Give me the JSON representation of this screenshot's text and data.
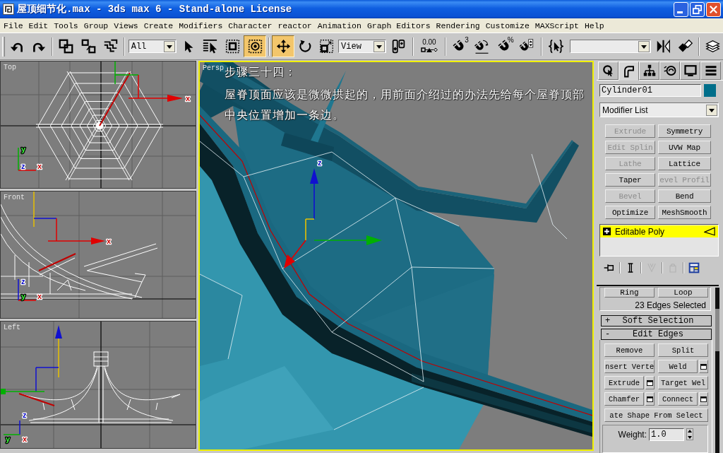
{
  "window": {
    "title": "屋顶细节化.max - 3ds max 6 - Stand-alone License",
    "controls": [
      {
        "kind": "minimize"
      },
      {
        "kind": "restore"
      },
      {
        "kind": "close"
      }
    ]
  },
  "menu": [
    "File",
    "Edit",
    "Tools",
    "Group",
    "Views",
    "Create",
    "Modifiers",
    "Character",
    "reactor",
    "Animation",
    "Graph Editors",
    "Rendering",
    "Customize",
    "MAXScript",
    "Help"
  ],
  "toolbar": [
    {
      "kind": "undo",
      "active": false
    },
    {
      "kind": "redo",
      "active": false
    },
    {
      "kind": "separator"
    },
    {
      "kind": "link",
      "active": false
    },
    {
      "kind": "unlink",
      "active": false
    },
    {
      "kind": "bind",
      "active": false
    },
    {
      "kind": "separator"
    },
    {
      "kind": "dropdown",
      "value": "All"
    },
    {
      "kind": "select",
      "active": false
    },
    {
      "kind": "select-by-name",
      "active": false
    },
    {
      "kind": "region",
      "active": false
    },
    {
      "kind": "crossing",
      "active": true
    },
    {
      "kind": "separator"
    },
    {
      "kind": "move",
      "active": true
    },
    {
      "kind": "rotate",
      "active": false
    },
    {
      "kind": "scale",
      "active": false
    },
    {
      "kind": "dropdown",
      "value": "View"
    },
    {
      "kind": "pivot",
      "active": false
    },
    {
      "kind": "separator"
    },
    {
      "kind": "spinner-snap",
      "badge": "0.00",
      "active": false
    },
    {
      "kind": "separator"
    },
    {
      "kind": "snap",
      "badge": "3",
      "active": false
    },
    {
      "kind": "angle-snap",
      "active": false
    },
    {
      "kind": "percent-snap",
      "badge": "%",
      "active": false
    },
    {
      "kind": "spinner-toggle",
      "active": false
    },
    {
      "kind": "separator"
    },
    {
      "kind": "named-sets",
      "active": false
    },
    {
      "kind": "named-field"
    },
    {
      "kind": "mirror",
      "active": false
    },
    {
      "kind": "align",
      "active": false
    },
    {
      "kind": "separator"
    },
    {
      "kind": "layers",
      "active": false
    }
  ],
  "viewports": [
    {
      "kind": "top",
      "label": "Top",
      "active": false,
      "axis_labels": [
        "x",
        "y",
        "z",
        "x"
      ]
    },
    {
      "kind": "front",
      "label": "Front",
      "active": false,
      "axis_labels": [
        "x",
        "z",
        "y",
        "x"
      ]
    },
    {
      "kind": "left",
      "label": "Left",
      "active": false,
      "axis_labels": [
        "z",
        "y",
        "x"
      ]
    }
  ],
  "perspective_viewport": {
    "label": "Persp",
    "active": true,
    "axis_labels": [
      "z"
    ],
    "heading": "步骤三十四：",
    "lines": [
      "屋脊顶面应该是微微拱起的，用前面介绍过的办法先给每个屋脊顶部",
      "中央位置增加一条边。"
    ]
  },
  "command_panel": {
    "tabs": [
      {
        "kind": "create",
        "selected": false
      },
      {
        "kind": "modify",
        "selected": true
      },
      {
        "kind": "hierarchy",
        "selected": false
      },
      {
        "kind": "motion",
        "selected": false
      },
      {
        "kind": "display",
        "selected": false
      },
      {
        "kind": "utilities",
        "selected": false
      }
    ],
    "object": {
      "name": "Cylinder01",
      "color": "#006e8a"
    },
    "modifier_list": "Modifier List",
    "modifier_buttons": [
      {
        "label": "Extrude",
        "disabled": true
      },
      {
        "label": "Symmetry",
        "disabled": false
      },
      {
        "label": "Edit Splin",
        "disabled": true
      },
      {
        "label": "UVW Map",
        "disabled": false
      },
      {
        "label": "Lathe",
        "disabled": true
      },
      {
        "label": "Lattice",
        "disabled": false
      },
      {
        "label": "Taper",
        "disabled": false
      },
      {
        "label": "evel Profil",
        "disabled": true
      },
      {
        "label": "Bevel",
        "disabled": true
      },
      {
        "label": "Bend",
        "disabled": false
      },
      {
        "label": "Optimize",
        "disabled": false
      },
      {
        "label": "MeshSmooth",
        "disabled": false
      }
    ],
    "stack": [
      {
        "label": "Editable Poly",
        "selected": true
      }
    ],
    "stack_tools": [
      {
        "kind": "pin",
        "disabled": false
      },
      {
        "kind": "show-end-result",
        "disabled": false
      },
      {
        "kind": "make-unique",
        "disabled": true
      },
      {
        "kind": "remove",
        "disabled": true
      },
      {
        "kind": "configure",
        "disabled": false
      }
    ],
    "selection": {
      "buttons": [
        "Ring",
        "Loop"
      ],
      "status": "23 Edges Selected"
    },
    "rollouts": [
      {
        "sign": "+",
        "title": "Soft Selection",
        "expanded": false
      },
      {
        "sign": "-",
        "title": "Edit Edges",
        "expanded": true,
        "buttons": [
          {
            "label": "Remove",
            "settings": false,
            "wide": false
          },
          {
            "label": "Split",
            "settings": false,
            "wide": false
          },
          {
            "label": "nsert Verte",
            "settings": false,
            "wide": false
          },
          {
            "label": "Weld",
            "settings": true,
            "wide": false
          },
          {
            "label": "Extrude",
            "settings": true,
            "wide": false
          },
          {
            "label": "Target Wel",
            "settings": false,
            "wide": false
          },
          {
            "label": "Chamfer",
            "settings": true,
            "wide": false
          },
          {
            "label": "Connect",
            "settings": true,
            "wide": false
          },
          {
            "label": "ate Shape From Select",
            "settings": false,
            "wide": true
          }
        ],
        "weight": {
          "label": "Weight:",
          "value": "1.0"
        }
      }
    ]
  }
}
